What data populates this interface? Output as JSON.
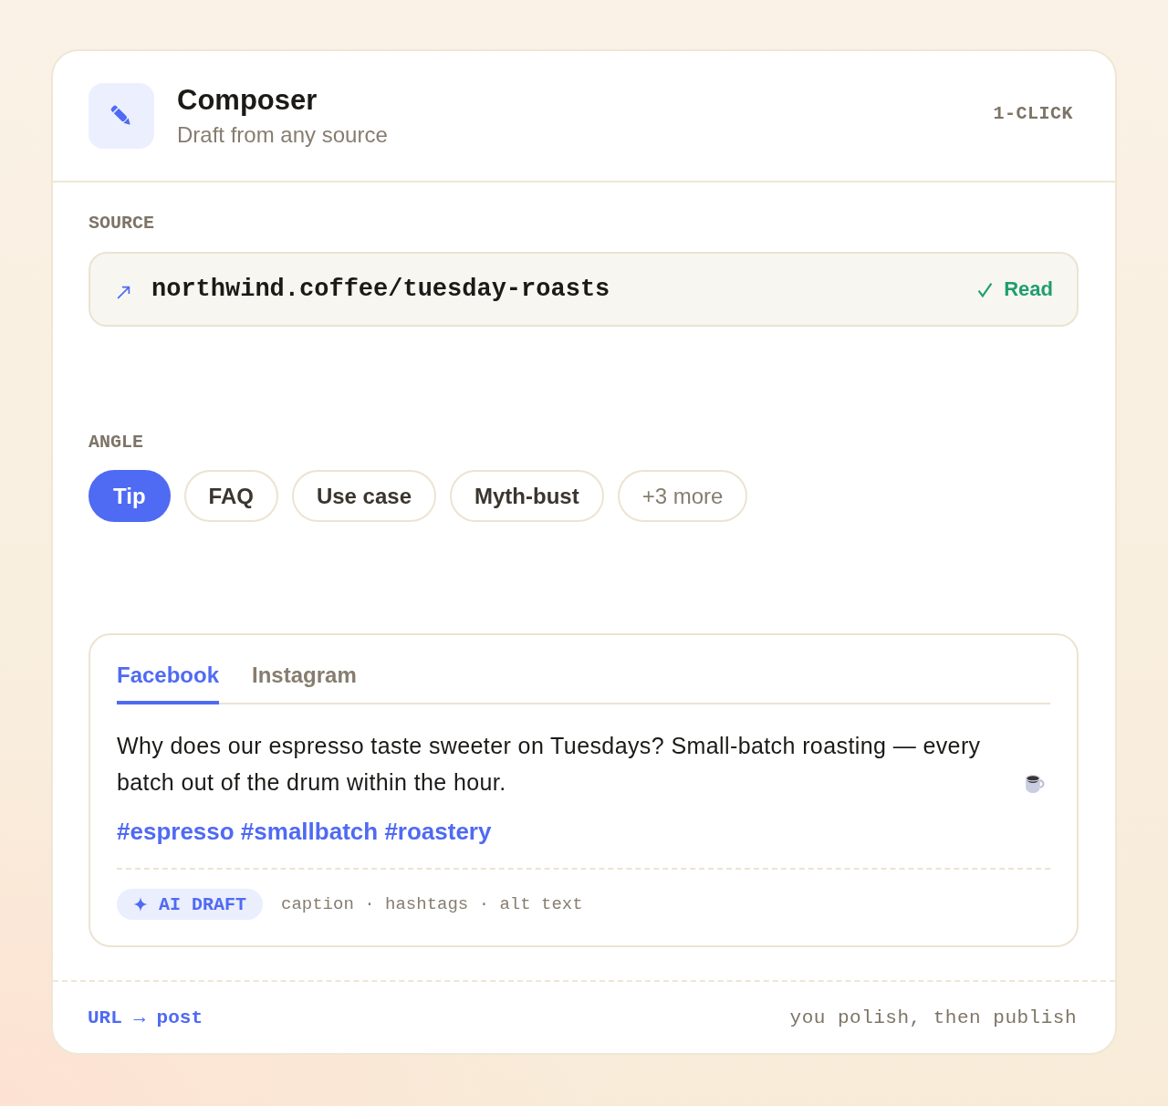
{
  "header": {
    "title": "Composer",
    "subtitle": "Draft from any source",
    "badge": "1-CLICK"
  },
  "source": {
    "label": "SOURCE",
    "url": "northwind.coffee/tuesday-roasts",
    "status": {
      "kind": "success",
      "label": "Read"
    }
  },
  "angle": {
    "label": "ANGLE",
    "options": [
      {
        "label": "Tip",
        "selected": true
      },
      {
        "label": "FAQ",
        "selected": false
      },
      {
        "label": "Use case",
        "selected": false
      },
      {
        "label": "Myth-bust",
        "selected": false
      }
    ],
    "more": "+3 more"
  },
  "preview": {
    "tabs": [
      {
        "label": "Facebook",
        "selected": true
      },
      {
        "label": "Instagram",
        "selected": false
      }
    ],
    "caption": "Why does our espresso taste sweeter on Tuesdays? Small-batch roasting — every batch out of the drum within the hour.",
    "hashtags": "#espresso #smallbatch #roastery",
    "badge": "AI DRAFT",
    "parts": "caption · hashtags · alt text"
  },
  "footer": {
    "flow": "URL → post",
    "note": "you polish, then publish"
  }
}
